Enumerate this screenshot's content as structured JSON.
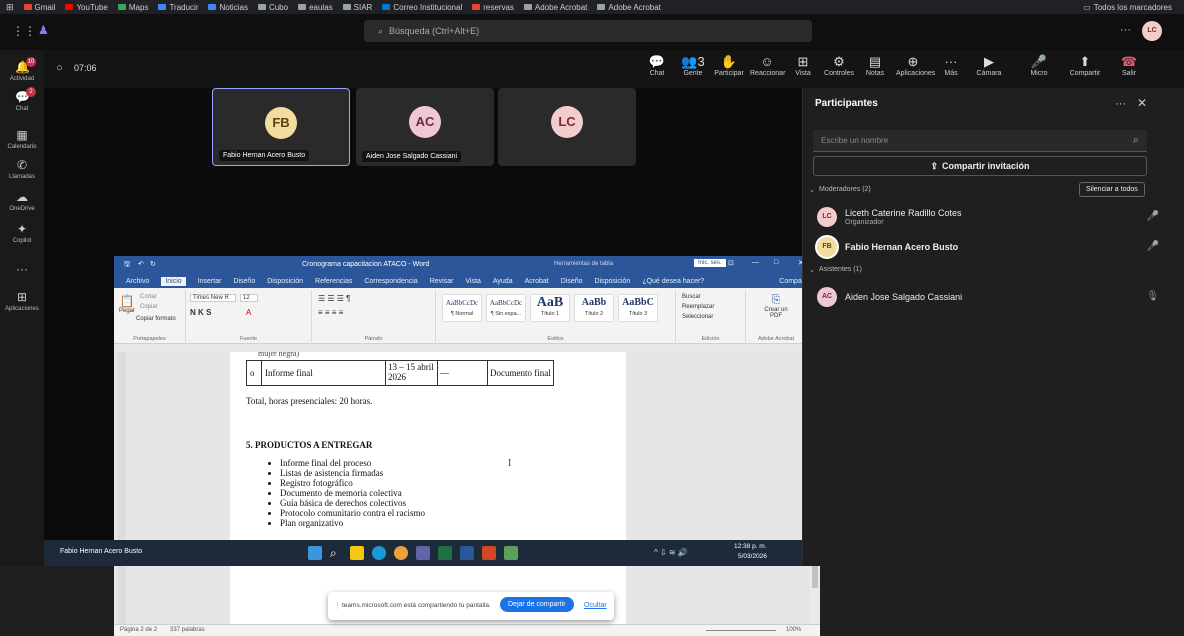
{
  "browser": {
    "bookmarks": [
      {
        "label": "Gmail",
        "color": "#ea4335"
      },
      {
        "label": "YouTube",
        "color": "#ff0000"
      },
      {
        "label": "Maps",
        "color": "#34a853"
      },
      {
        "label": "Traducir",
        "color": "#4285f4"
      },
      {
        "label": "Noticias",
        "color": "#4285f4"
      },
      {
        "label": "Cubo",
        "color": "#9aa0a6"
      },
      {
        "label": "eaulas",
        "color": "#9aa0a6"
      },
      {
        "label": "SIAR",
        "color": "#9aa0a6"
      },
      {
        "label": "Correo Institucional",
        "color": "#0078d4"
      },
      {
        "label": "reservas",
        "color": "#ea4335"
      },
      {
        "label": "Adobe Acrobat",
        "color": "#9aa0a6"
      },
      {
        "label": "Adobe Acrobat",
        "color": "#9aa0a6"
      }
    ],
    "all_bookmarks": "Todos los marcadores"
  },
  "teams": {
    "search_placeholder": "Búsqueda (Ctrl+Alt+E)",
    "profile_initials": "LC",
    "rail": [
      {
        "label": "Actividad",
        "icon": "bell-icon",
        "badge": "10"
      },
      {
        "label": "Chat",
        "icon": "chat-icon",
        "badge": "2"
      },
      {
        "label": "Calendario",
        "icon": "calendar-icon",
        "badge": ""
      },
      {
        "label": "Llamadas",
        "icon": "phone-icon",
        "badge": ""
      },
      {
        "label": "OneDrive",
        "icon": "cloud-icon",
        "badge": ""
      },
      {
        "label": "Copilot",
        "icon": "copilot-icon",
        "badge": ""
      },
      {
        "label": "...",
        "icon": "more-icon",
        "badge": ""
      },
      {
        "label": "Aplicaciones",
        "icon": "apps-icon",
        "badge": ""
      }
    ],
    "meeting": {
      "timer": "07:06",
      "toolbar": [
        {
          "label": "Chat",
          "icon": "chat-icon"
        },
        {
          "label": "Gente",
          "icon": "people-icon",
          "count": "3"
        },
        {
          "label": "Participar",
          "icon": "hand-icon"
        },
        {
          "label": "Reaccionar",
          "icon": "emoji-icon"
        },
        {
          "label": "Vista",
          "icon": "grid-icon"
        },
        {
          "label": "Controles",
          "icon": "controls-icon"
        },
        {
          "label": "Notas",
          "icon": "notes-icon"
        },
        {
          "label": "Aplicaciones",
          "icon": "plus-icon"
        },
        {
          "label": "Más",
          "icon": "more-icon"
        }
      ],
      "media": [
        {
          "label": "Cámara",
          "icon": "camera-off-icon"
        },
        {
          "label": "Micro",
          "icon": "mic-icon"
        },
        {
          "label": "Compartir",
          "icon": "share-icon"
        },
        {
          "label": "Salir",
          "icon": "leave-icon"
        }
      ]
    },
    "tiles": [
      {
        "initials": "FB",
        "name": "Fabio Hernan Acero Busto",
        "bg": "#f3dca0",
        "fg": "#5a4310"
      },
      {
        "initials": "AC",
        "name": "Aiden Jose Salgado Cassiani",
        "bg": "#f0c8d4",
        "fg": "#6b2a40"
      },
      {
        "initials": "LC",
        "name": "",
        "bg": "#f4cccc",
        "fg": "#7a2b2b"
      }
    ],
    "presenter_name": "Fabio Hernan Acero Busto",
    "share_notice": {
      "text": "teams.microsoft.com está compartiendo tu pantalla.",
      "stop": "Dejar de compartir",
      "hide": "Ocultar"
    }
  },
  "word": {
    "title": "Cronograma capacitacion ATACO - Word",
    "tools_label": "Herramientas de tabla",
    "signin": "Inic. ses.",
    "tabs": [
      "Archivo",
      "Inicio",
      "Insertar",
      "Diseño",
      "Disposición",
      "Referencias",
      "Correspondencia",
      "Revisar",
      "Vista",
      "Ayuda",
      "Acrobat",
      "Diseño",
      "Disposición",
      "¿Qué desea hacer?"
    ],
    "share": "Compartir",
    "ribbon": {
      "paste": "Pegar",
      "cut": "Cortar",
      "copy": "Copiar",
      "copy_format": "Copiar formato",
      "clipboard": "Portapapeles",
      "font_name": "Times New R",
      "font_size": "12",
      "font_label": "Fuente",
      "paragraph_label": "Párrafo",
      "styles": [
        {
          "sample": "AaBbCcDc",
          "name": "¶ Normal"
        },
        {
          "sample": "AaBbCcDc",
          "name": "¶ Sin espa..."
        },
        {
          "sample": "AaB",
          "name": "Título 1"
        },
        {
          "sample": "AaBb",
          "name": "Título 2"
        },
        {
          "sample": "AaBbC",
          "name": "Título 3"
        }
      ],
      "styles_label": "Estilos",
      "find": "Buscar",
      "replace": "Reemplazar",
      "select": "Seleccionar",
      "editing_label": "Edición",
      "pdf": "Crear un PDF",
      "acrobat_label": "Adobe Acrobat"
    },
    "doc": {
      "row_partial": "mujer negra)",
      "table_row": {
        "bullet": "o",
        "activity": "Informe final",
        "date": "13 – 15 abril 2026",
        "hours": "—",
        "product": "Documento final"
      },
      "total": "Total, horas presenciales: 20 horas.",
      "section_title": "5. PRODUCTOS A ENTREGAR",
      "items": [
        "Informe final del proceso",
        "Listas de asistencia firmadas",
        "Registro fotográfico",
        "Documento de memoria colectiva",
        "Guía básica de derechos colectivos",
        "Protocolo comunitario contra el racismo",
        "Plan organizativo"
      ]
    },
    "status": {
      "page": "Página 2 de 2",
      "words": "337 palabras",
      "zoom": "100%"
    }
  },
  "taskbar": {
    "time": "12:38 p. m.",
    "date": "5/03/2026"
  },
  "panel": {
    "title": "Participantes",
    "search_placeholder": "Escribe un nombre",
    "invite": "Compartir invitación",
    "moderators_label": "Moderadores (2)",
    "mute_all": "Silenciar a todos",
    "moderators": [
      {
        "initials": "LC",
        "name": "Liceth Caterine Radillo Cotes",
        "role": "Organizador",
        "bg": "#f4cccc",
        "fg": "#7a2b2b"
      },
      {
        "initials": "FB",
        "name": "Fabio Hernan Acero Busto",
        "role": "",
        "bg": "#f3dca0",
        "fg": "#5a4310"
      }
    ],
    "attendees_label": "Asistentes (1)",
    "attendees": [
      {
        "initials": "AC",
        "name": "Aiden Jose Salgado Cassiani",
        "bg": "#f0c8d4",
        "fg": "#6b2a40"
      }
    ]
  }
}
